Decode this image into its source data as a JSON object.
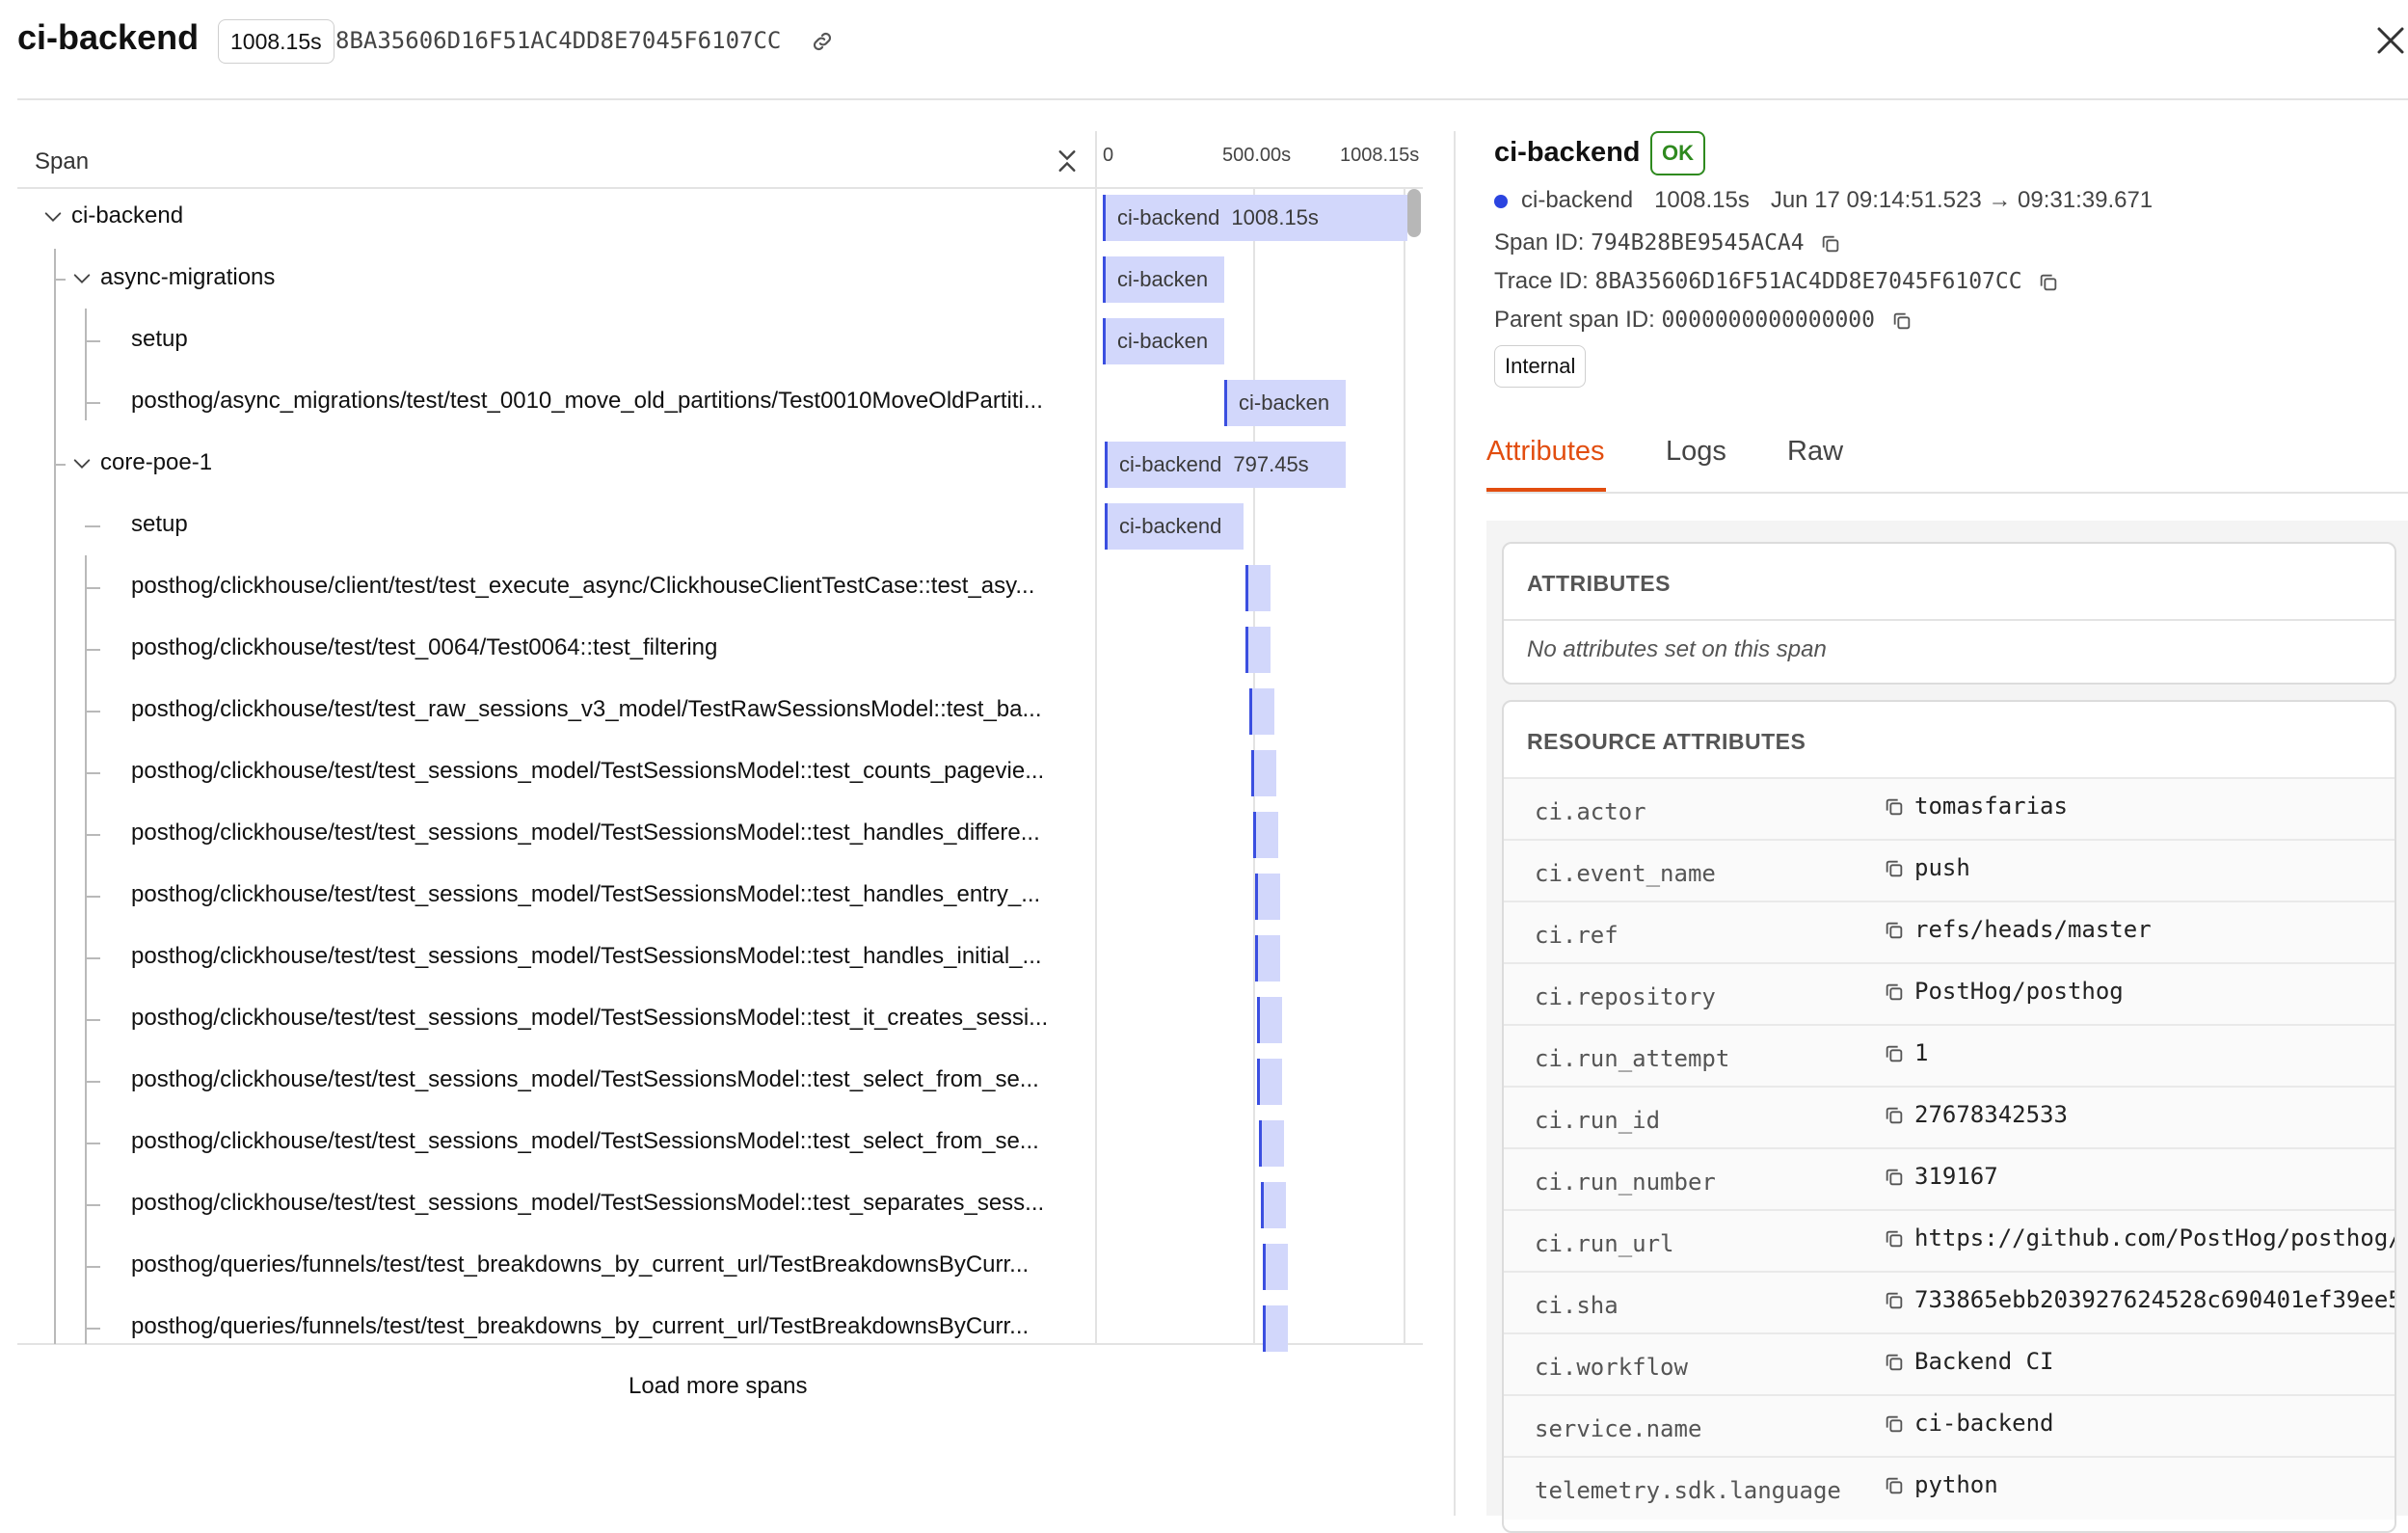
{
  "header": {
    "title": "ci-backend",
    "duration_badge": "1008.15s",
    "trace_id": "8BA35606D16F51AC4DD8E7045F6107CC"
  },
  "tree": {
    "column_label": "Span",
    "ticks": [
      "0",
      "500.00s",
      "1008.15s"
    ],
    "load_more": "Load more spans",
    "rows": [
      {
        "label": "ci-backend",
        "bar_text": "ci-backend",
        "bar_dur": "1008.15s"
      },
      {
        "label": "async-migrations",
        "bar_text": "ci-backen",
        "bar_dur": ""
      },
      {
        "label": "setup",
        "bar_text": "ci-backen",
        "bar_dur": ""
      },
      {
        "label": "posthog/async_migrations/test/test_0010_move_old_partitions/Test0010MoveOldPartiti...",
        "bar_text": "ci-backen",
        "bar_dur": ""
      },
      {
        "label": "core-poe-1",
        "bar_text": "ci-backend",
        "bar_dur": "797.45s"
      },
      {
        "label": "setup",
        "bar_text": "ci-backend",
        "bar_dur": ""
      },
      {
        "label": "posthog/clickhouse/client/test/test_execute_async/ClickhouseClientTestCase::test_asy...",
        "bar_text": "",
        "bar_dur": ""
      },
      {
        "label": "posthog/clickhouse/test/test_0064/Test0064::test_filtering",
        "bar_text": "",
        "bar_dur": ""
      },
      {
        "label": "posthog/clickhouse/test/test_raw_sessions_v3_model/TestRawSessionsModel::test_ba...",
        "bar_text": "",
        "bar_dur": ""
      },
      {
        "label": "posthog/clickhouse/test/test_sessions_model/TestSessionsModel::test_counts_pagevie...",
        "bar_text": "",
        "bar_dur": ""
      },
      {
        "label": "posthog/clickhouse/test/test_sessions_model/TestSessionsModel::test_handles_differe...",
        "bar_text": "",
        "bar_dur": ""
      },
      {
        "label": "posthog/clickhouse/test/test_sessions_model/TestSessionsModel::test_handles_entry_...",
        "bar_text": "",
        "bar_dur": ""
      },
      {
        "label": "posthog/clickhouse/test/test_sessions_model/TestSessionsModel::test_handles_initial_...",
        "bar_text": "",
        "bar_dur": ""
      },
      {
        "label": "posthog/clickhouse/test/test_sessions_model/TestSessionsModel::test_it_creates_sessi...",
        "bar_text": "",
        "bar_dur": ""
      },
      {
        "label": "posthog/clickhouse/test/test_sessions_model/TestSessionsModel::test_select_from_se...",
        "bar_text": "",
        "bar_dur": ""
      },
      {
        "label": "posthog/clickhouse/test/test_sessions_model/TestSessionsModel::test_select_from_se...",
        "bar_text": "",
        "bar_dur": ""
      },
      {
        "label": "posthog/clickhouse/test/test_sessions_model/TestSessionsModel::test_separates_sess...",
        "bar_text": "",
        "bar_dur": ""
      },
      {
        "label": "posthog/queries/funnels/test/test_breakdowns_by_current_url/TestBreakdownsByCurr...",
        "bar_text": "",
        "bar_dur": ""
      },
      {
        "label": "posthog/queries/funnels/test/test_breakdowns_by_current_url/TestBreakdownsByCurr...",
        "bar_text": "",
        "bar_dur": ""
      }
    ]
  },
  "detail": {
    "title": "ci-backend",
    "status": "OK",
    "service": "ci-backend",
    "duration": "1008.15s",
    "time_range": "Jun 17 09:14:51.523 → 09:31:39.671",
    "span_id_label": "Span ID:",
    "span_id": "794B28BE9545ACA4",
    "trace_id_label": "Trace ID:",
    "trace_id": "8BA35606D16F51AC4DD8E7045F6107CC",
    "parent_label": "Parent span ID:",
    "parent_id": "0000000000000000",
    "kind": "Internal",
    "tabs": [
      "Attributes",
      "Logs",
      "Raw"
    ],
    "attributes_title": "ATTRIBUTES",
    "attributes_empty": "No attributes set on this span",
    "resource_title": "RESOURCE ATTRIBUTES",
    "resource": [
      {
        "key": "ci.actor",
        "value": "tomasfarias"
      },
      {
        "key": "ci.event_name",
        "value": "push"
      },
      {
        "key": "ci.ref",
        "value": "refs/heads/master"
      },
      {
        "key": "ci.repository",
        "value": "PostHog/posthog"
      },
      {
        "key": "ci.run_attempt",
        "value": "1"
      },
      {
        "key": "ci.run_id",
        "value": "27678342533"
      },
      {
        "key": "ci.run_number",
        "value": "319167"
      },
      {
        "key": "ci.run_url",
        "value": "https://github.com/PostHog/posthog/"
      },
      {
        "key": "ci.sha",
        "value": "733865ebb203927624528c690401ef39ee5"
      },
      {
        "key": "ci.workflow",
        "value": "Backend CI"
      },
      {
        "key": "service.name",
        "value": "ci-backend"
      },
      {
        "key": "telemetry.sdk.language",
        "value": "python"
      }
    ]
  },
  "colors": {
    "accent": "#e24d0f",
    "ok": "#2f8a1f",
    "bar": "#d2d7fb",
    "bar_edge": "#3b4fe0"
  }
}
